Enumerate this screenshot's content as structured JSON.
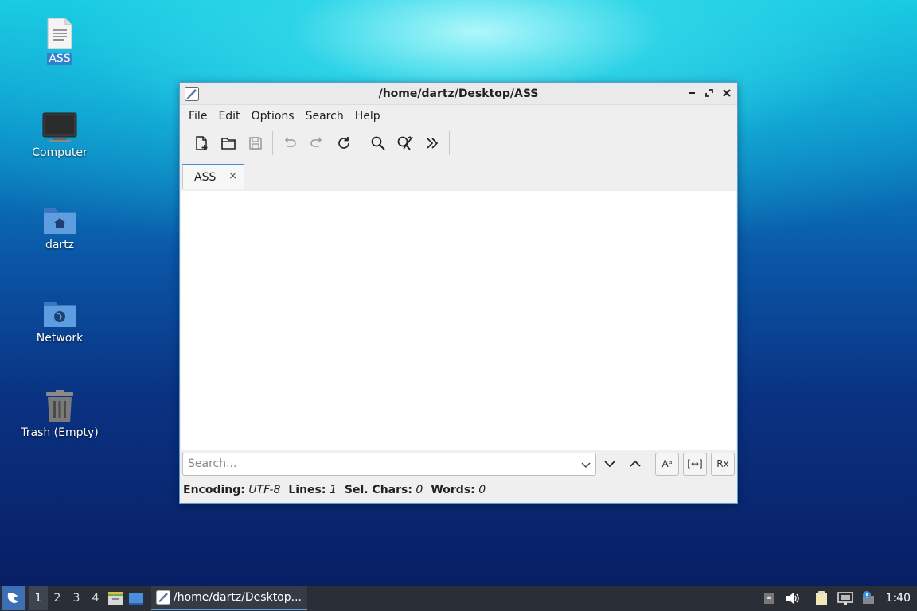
{
  "desktop": {
    "icons": [
      {
        "label": "ASS",
        "icon": "text-file-icon"
      },
      {
        "label": "Computer",
        "icon": "computer-icon"
      },
      {
        "label": "dartz",
        "icon": "home-folder-icon"
      },
      {
        "label": "Network",
        "icon": "network-folder-icon"
      },
      {
        "label": "Trash (Empty)",
        "icon": "trash-icon"
      }
    ]
  },
  "window": {
    "title": "/home/dartz/Desktop/ASS",
    "menu": [
      "File",
      "Edit",
      "Options",
      "Search",
      "Help"
    ],
    "toolbar": [
      "new-file-icon",
      "open-folder-icon",
      "save-icon",
      "undo-icon",
      "redo-icon",
      "reload-icon",
      "find-icon",
      "replace-icon",
      "more-icon"
    ],
    "tab": {
      "label": "ASS",
      "close": "×"
    },
    "search": {
      "placeholder": "Search...",
      "value": ""
    },
    "search_options": {
      "match_case": "Aᵃ",
      "whole_word": "[↔]",
      "regex": "Rx"
    },
    "status": {
      "encoding_label": "Encoding:",
      "encoding_value": "UTF-8",
      "lines_label": "Lines:",
      "lines_value": "1",
      "selchars_label": "Sel. Chars:",
      "selchars_value": "0",
      "words_label": "Words:",
      "words_value": "0"
    }
  },
  "taskbar": {
    "workspaces": [
      "1",
      "2",
      "3",
      "4"
    ],
    "active_workspace": "1",
    "task_label": "/home/dartz/Desktop...",
    "clock": "1:40"
  },
  "colors": {
    "accent": "#3d8fd8",
    "taskbar": "#2a2e36",
    "window_border": "#5e9ad8"
  }
}
